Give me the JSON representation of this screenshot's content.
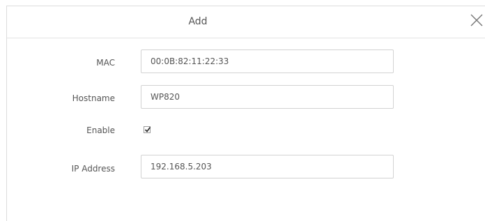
{
  "dialog": {
    "title": "Add",
    "close_icon": "close-icon"
  },
  "form": {
    "mac": {
      "label": "MAC",
      "value": "00:0B:82:11:22:33"
    },
    "hostname": {
      "label": "Hostname",
      "value": "WP820"
    },
    "enable": {
      "label": "Enable",
      "checked": true
    },
    "ip_address": {
      "label": "IP Address",
      "value": "192.168.5.203"
    }
  }
}
